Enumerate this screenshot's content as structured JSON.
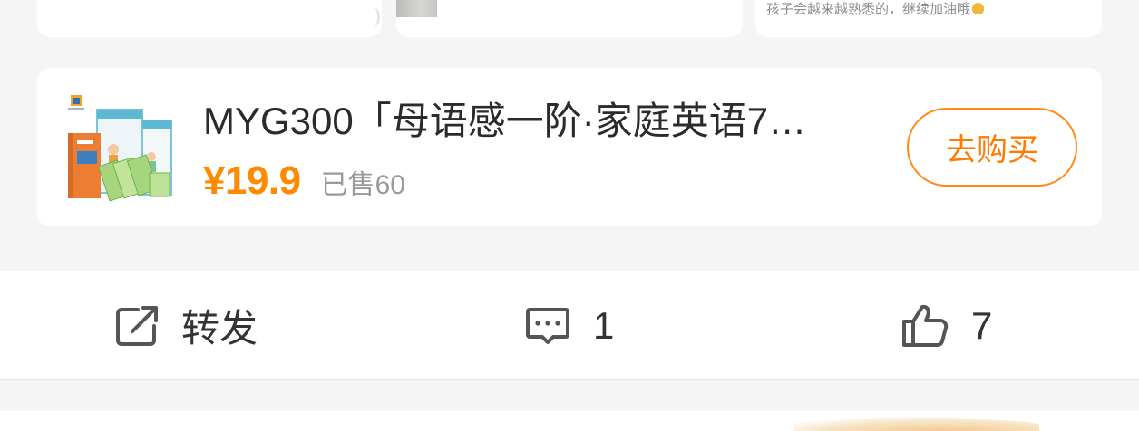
{
  "feed": {
    "top_cards": {
      "third_snippet": "孩子会越来越熟悉的，继续加油哦"
    }
  },
  "product": {
    "title": "MYG300「母语感一阶·家庭英语7…",
    "price": "¥19.9",
    "sold": "已售60",
    "buy_label": "去购买",
    "accent_color": "#ff8a00"
  },
  "actions": {
    "share_label": "转发",
    "comment_count": "1",
    "like_count": "7",
    "share_icon": "share-icon",
    "comment_icon": "comment-icon",
    "like_icon": "thumbs-up-icon"
  }
}
